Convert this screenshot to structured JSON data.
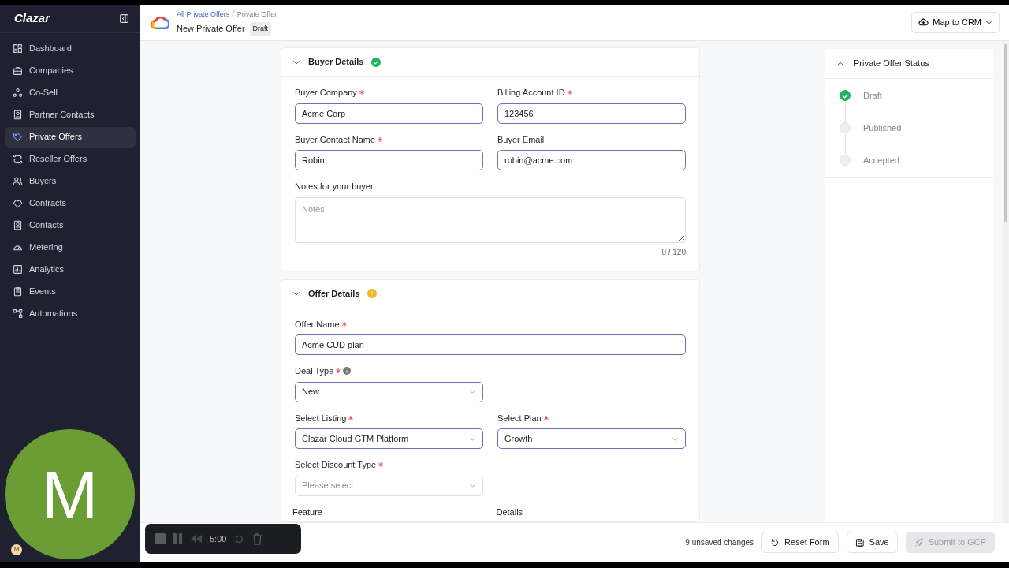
{
  "sidebar": {
    "logo": "Clazar",
    "items": [
      {
        "label": "Dashboard",
        "selected": false
      },
      {
        "label": "Companies",
        "selected": false
      },
      {
        "label": "Co-Sell",
        "selected": false
      },
      {
        "label": "Partner Contacts",
        "selected": false
      },
      {
        "label": "Private Offers",
        "selected": true
      },
      {
        "label": "Reseller Offers",
        "selected": false
      },
      {
        "label": "Buyers",
        "selected": false
      },
      {
        "label": "Contracts",
        "selected": false
      },
      {
        "label": "Contacts",
        "selected": false
      },
      {
        "label": "Metering",
        "selected": false
      },
      {
        "label": "Analytics",
        "selected": false
      },
      {
        "label": "Events",
        "selected": false
      },
      {
        "label": "Automations",
        "selected": false
      }
    ],
    "user_avatar": "M"
  },
  "header": {
    "breadcrumb": [
      "All Private Offers",
      "Private Offer"
    ],
    "title": "New Private Offer",
    "badge": "Draft",
    "button": "Map to CRM"
  },
  "sections": [
    {
      "title": "Buyer Details",
      "complete": true,
      "expanded": true,
      "rows": [
        [
          {
            "kind": "input",
            "label": "Buyer Company",
            "required": true,
            "value": "Acme Corp"
          },
          {
            "kind": "input",
            "label": "Billing Account ID",
            "required": true,
            "value": "123456"
          }
        ],
        [
          {
            "kind": "input",
            "label": "Buyer Contact Name",
            "required": true,
            "value": "Robin"
          },
          {
            "kind": "input",
            "label": "Buyer Email",
            "required": false,
            "value": "robin@acme.com"
          }
        ],
        [
          {
            "kind": "textarea",
            "label": "Notes for your buyer",
            "required": false,
            "placeholder": "Notes",
            "counter": "0 / 120"
          }
        ]
      ]
    },
    {
      "title": "Offer Details",
      "complete": false,
      "expanded": true,
      "rows": [
        [
          {
            "kind": "input",
            "label": "Offer Name",
            "required": true,
            "value": "Acme CUD plan"
          }
        ],
        [
          {
            "kind": "select",
            "label": "Deal Type",
            "required": true,
            "info": true,
            "value": "New"
          }
        ],
        [
          {
            "kind": "select",
            "label": "Select Listing",
            "required": true,
            "value": "Clazar Cloud GTM Platform"
          },
          {
            "kind": "select",
            "label": "Select Plan",
            "required": true,
            "value": "Growth"
          }
        ],
        [
          {
            "kind": "select",
            "label": "Select Discount Type",
            "required": true,
            "placeholder": "Please select"
          }
        ]
      ],
      "table_columns": [
        "Feature",
        "Details"
      ]
    }
  ],
  "status_panel": {
    "title": "Private Offer Status",
    "expanded": true,
    "steps": [
      {
        "label": "Draft",
        "done": true
      },
      {
        "label": "Published",
        "done": false
      },
      {
        "label": "Accepted",
        "done": false
      }
    ]
  },
  "footer": {
    "unsaved": "9 unsaved changes",
    "buttons": [
      {
        "label": "Reset Form",
        "disabled": false
      },
      {
        "label": "Save",
        "disabled": false
      },
      {
        "label": "Submit to GCP",
        "disabled": true
      }
    ]
  },
  "recorder": {
    "time": "5:00"
  },
  "webcam": {
    "initial": "M"
  }
}
